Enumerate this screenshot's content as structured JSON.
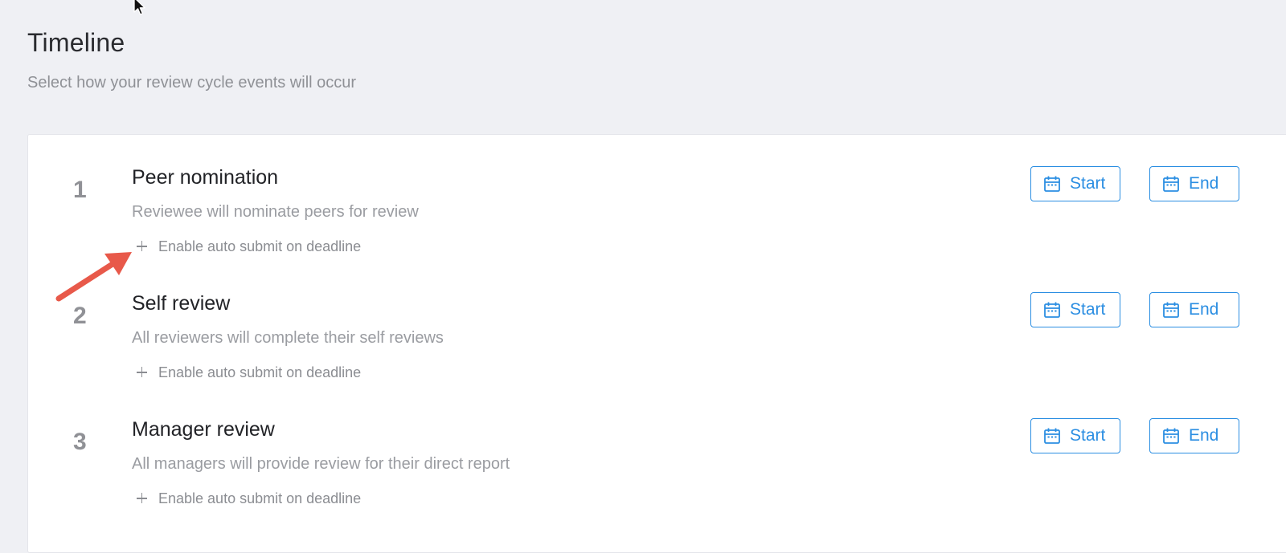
{
  "header": {
    "title": "Timeline",
    "subtitle": "Select how your review cycle events will occur"
  },
  "steps": [
    {
      "number": "1",
      "title": "Peer nomination",
      "description": "Reviewee will nominate peers for review",
      "auto_submit_label": "Enable auto submit on deadline",
      "start_label": "Start",
      "end_label": "End"
    },
    {
      "number": "2",
      "title": "Self review",
      "description": "All reviewers will complete their self reviews",
      "auto_submit_label": "Enable auto submit on deadline",
      "start_label": "Start",
      "end_label": "End"
    },
    {
      "number": "3",
      "title": "Manager review",
      "description": "All managers will provide review for their direct report",
      "auto_submit_label": "Enable auto submit on deadline",
      "start_label": "Start",
      "end_label": "End"
    }
  ],
  "icons": {
    "date_button": "calendar-icon",
    "auto_submit": "plus-icon",
    "pointer": "mouse-cursor-icon",
    "annotation": "red-arrow-annotation"
  },
  "colors": {
    "accent": "#2b8ee2",
    "background": "#eff0f4",
    "card": "#ffffff",
    "annotation": "#e8594a"
  }
}
